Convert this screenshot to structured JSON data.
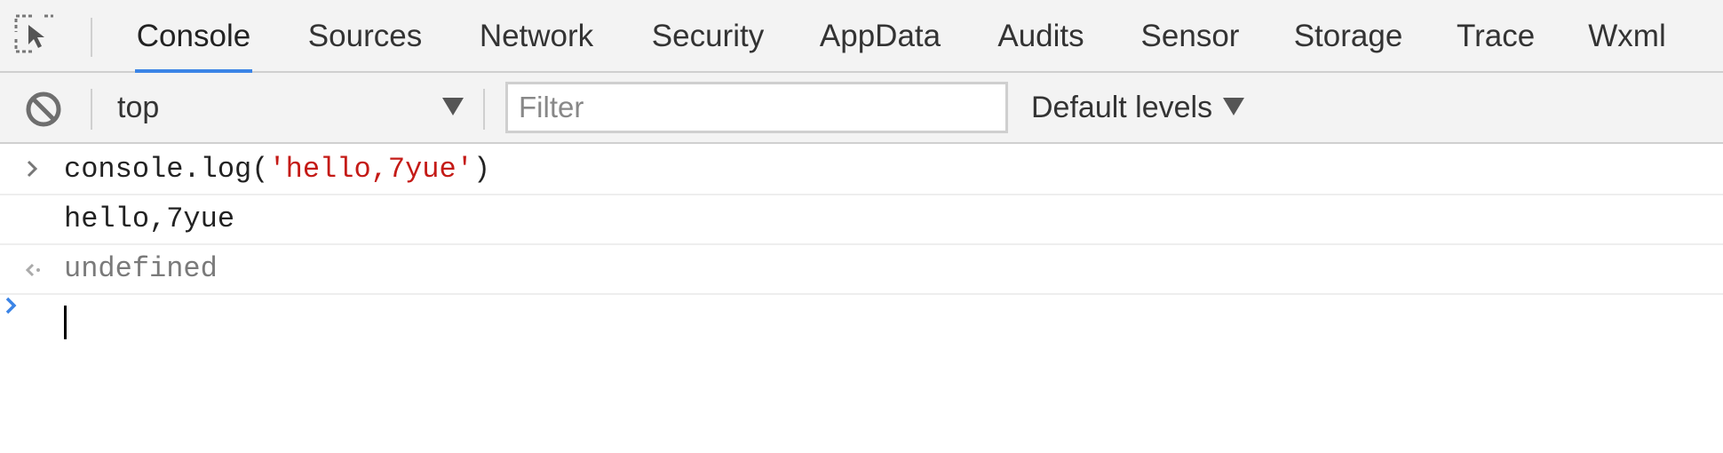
{
  "tabs": [
    {
      "label": "Console",
      "active": true
    },
    {
      "label": "Sources",
      "active": false
    },
    {
      "label": "Network",
      "active": false
    },
    {
      "label": "Security",
      "active": false
    },
    {
      "label": "AppData",
      "active": false
    },
    {
      "label": "Audits",
      "active": false
    },
    {
      "label": "Sensor",
      "active": false
    },
    {
      "label": "Storage",
      "active": false
    },
    {
      "label": "Trace",
      "active": false
    },
    {
      "label": "Wxml",
      "active": false
    }
  ],
  "toolbar": {
    "context_label": "top",
    "filter_placeholder": "Filter",
    "filter_value": "",
    "levels_label": "Default levels"
  },
  "console": {
    "input_code_prefix": "console.log(",
    "input_code_string": "'hello,7yue'",
    "input_code_suffix": ")",
    "log_output": "hello,7yue",
    "return_value": "undefined",
    "prompt_value": ""
  },
  "icons": {
    "inspect": "inspect-element-icon",
    "clear": "clear-console-icon",
    "context_dropdown": "caret-down-icon",
    "levels_dropdown": "caret-down-icon",
    "input_prompt": "chevron-right-icon",
    "result": "return-arrow-icon",
    "active_prompt": "chevron-right-icon"
  },
  "colors": {
    "accent": "#3b84e6",
    "string": "#c41a16",
    "result_text": "#7a7a7a",
    "toolbar_bg": "#f3f3f3"
  }
}
